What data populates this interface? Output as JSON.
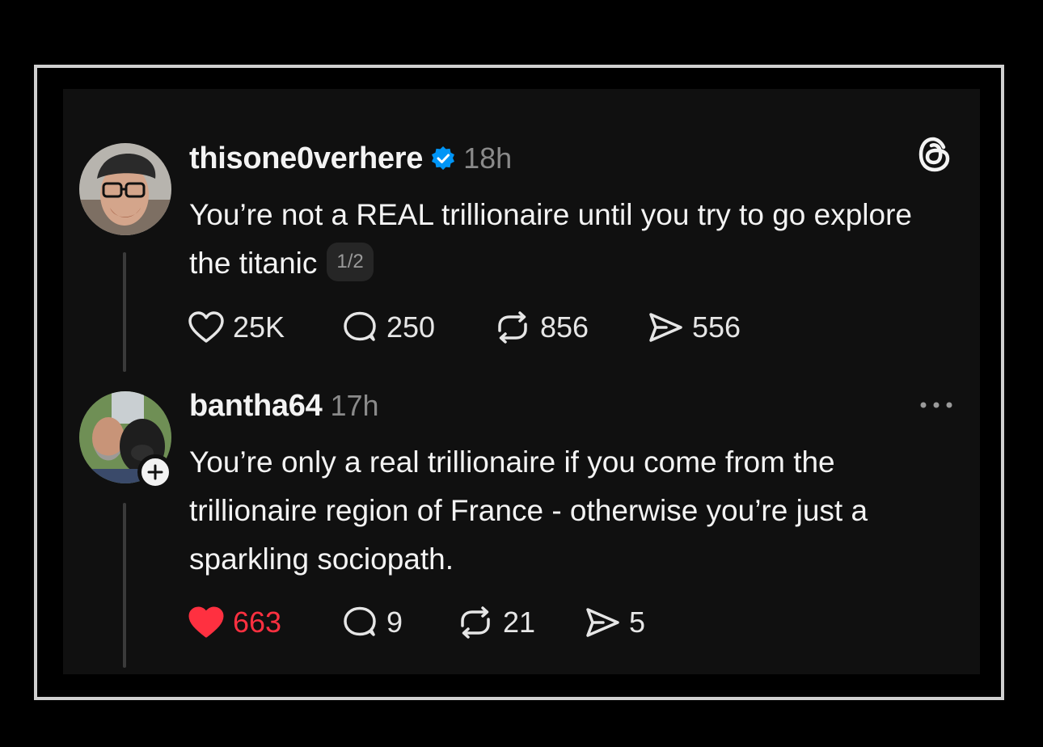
{
  "app": "Threads",
  "posts": [
    {
      "username": "thisone0verhere",
      "verified": true,
      "time": "18h",
      "text": "You’re not a REAL trillionaire until you try to go explore the titanic",
      "pager": "1/2",
      "likes": "25K",
      "replies": "250",
      "reposts": "856",
      "shares": "556",
      "liked": false
    },
    {
      "username": "bantha64",
      "verified": false,
      "time": "17h",
      "text": "You’re only a real trillionaire if you come from the trillionaire region of France - otherwise you’re just a sparkling sociopath.",
      "likes": "663",
      "replies": "9",
      "reposts": "21",
      "shares": "5",
      "liked": true
    }
  ],
  "colors": {
    "background": "#000000",
    "panel": "#101010",
    "text": "#f3f3f3",
    "muted": "#8a8a8a",
    "verified_blue": "#0095f6",
    "like_red": "#ff3040"
  },
  "icons": [
    "threads-logo-icon",
    "verified-badge-icon",
    "heart-icon",
    "comment-icon",
    "repost-icon",
    "share-icon",
    "more-icon",
    "follow-plus-icon"
  ]
}
